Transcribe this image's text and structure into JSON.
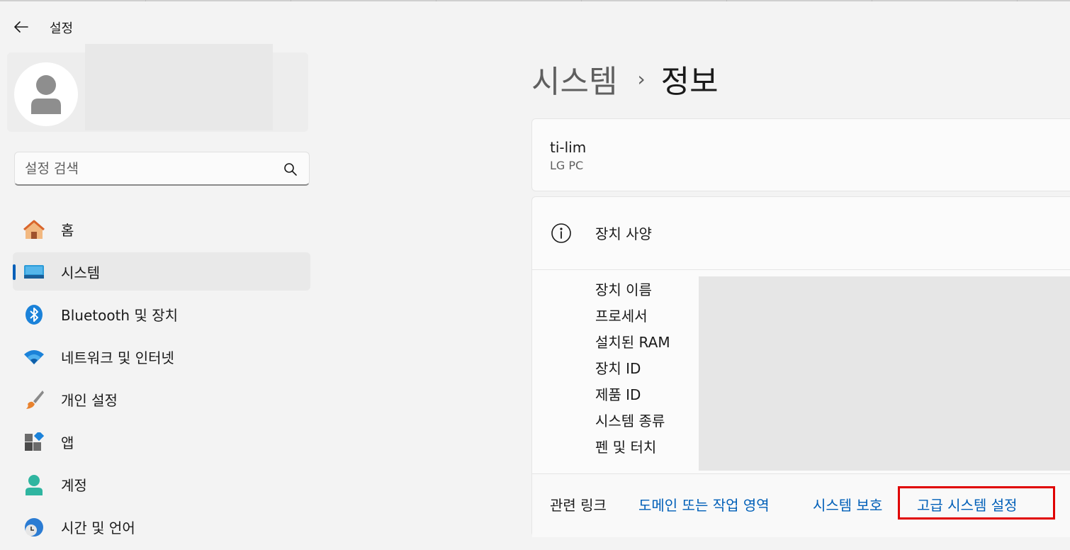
{
  "window": {
    "app_title": "설정",
    "back_icon": "back-arrow-icon"
  },
  "search": {
    "placeholder": "설정 검색",
    "icon": "search-icon"
  },
  "sidebar": {
    "items": [
      {
        "label": "홈",
        "icon": "home-icon",
        "selected": false
      },
      {
        "label": "시스템",
        "icon": "system-icon",
        "selected": true
      },
      {
        "label": "Bluetooth 및 장치",
        "icon": "bluetooth-icon",
        "selected": false
      },
      {
        "label": "네트워크 및 인터넷",
        "icon": "wifi-icon",
        "selected": false
      },
      {
        "label": "개인 설정",
        "icon": "brush-icon",
        "selected": false
      },
      {
        "label": "앱",
        "icon": "apps-icon",
        "selected": false
      },
      {
        "label": "계정",
        "icon": "account-icon",
        "selected": false
      },
      {
        "label": "시간 및 언어",
        "icon": "clock-globe-icon",
        "selected": false
      }
    ]
  },
  "header": {
    "parent": "시스템",
    "separator": "›",
    "current": "정보"
  },
  "device": {
    "name": "ti-lim",
    "model": "LG PC"
  },
  "specs": {
    "title": "장치 사양",
    "labels": [
      "장치 이름",
      "프로세서",
      "설치된 RAM",
      "장치 ID",
      "제품 ID",
      "시스템 종류",
      "펜 및 터치"
    ]
  },
  "related_links": {
    "label": "관련 링크",
    "domain": "도메인 또는 작업 영역",
    "protection": "시스템 보호",
    "advanced": "고급 시스템 설정"
  },
  "colors": {
    "accent": "#005fb8",
    "highlight": "#e00000",
    "background": "#f3f3f3"
  }
}
